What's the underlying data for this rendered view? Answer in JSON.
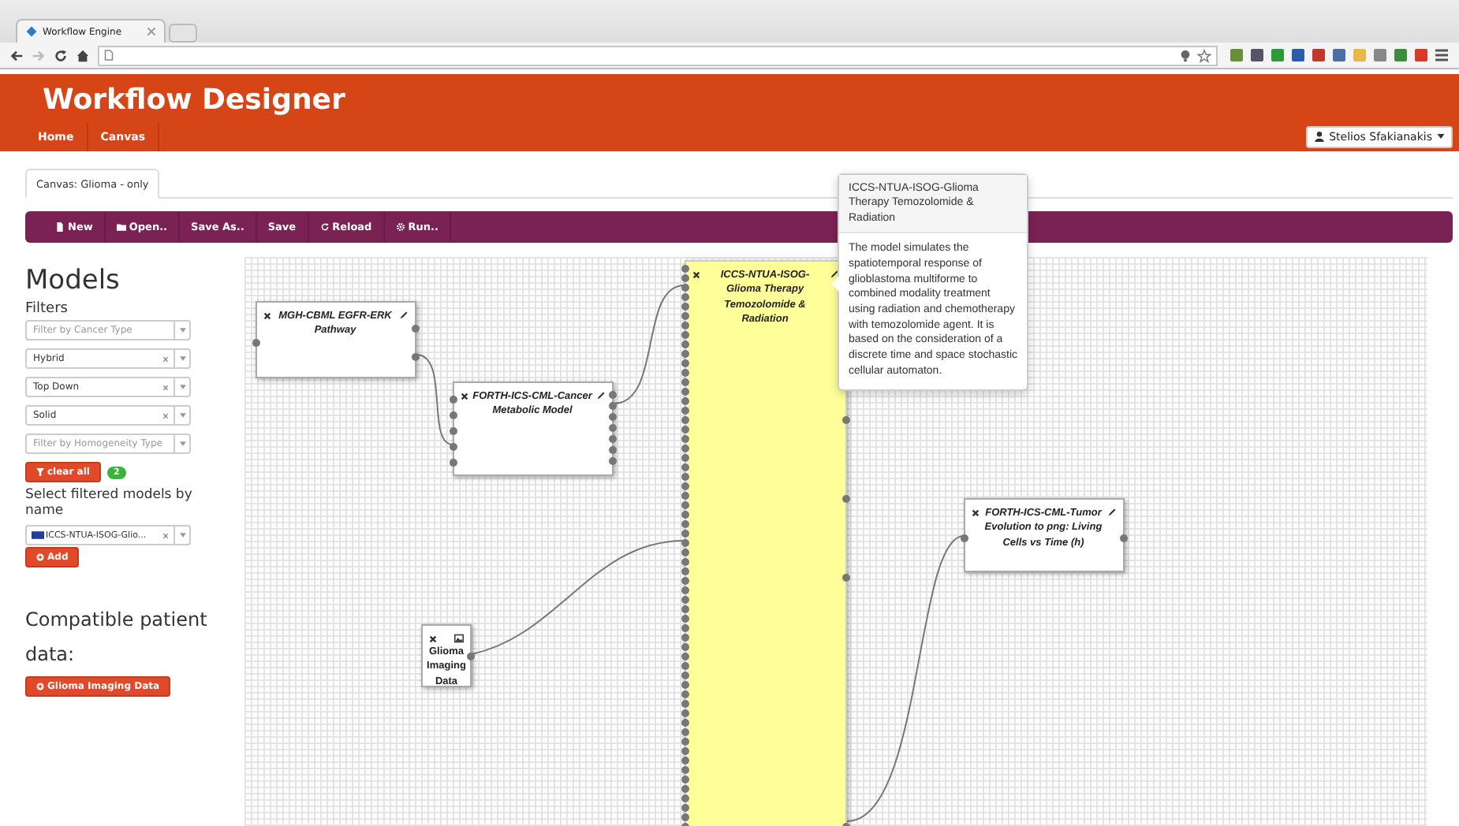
{
  "browser": {
    "tab_title": "Workflow Engine"
  },
  "app": {
    "title": "Workflow Designer",
    "nav": [
      {
        "label": "Home",
        "selected": false
      },
      {
        "label": "Canvas",
        "selected": false
      }
    ],
    "user": "Stelios Sfakianakis"
  },
  "canvas_tabs": [
    {
      "label": "Canvas: Glioma - only",
      "selected": true
    }
  ],
  "toolbar": [
    {
      "label": "New",
      "kind": "file"
    },
    {
      "label": "Open..",
      "kind": "folder"
    },
    {
      "label": "Save As..",
      "kind": "plain"
    },
    {
      "label": "Save",
      "kind": "plain"
    },
    {
      "label": "Reload",
      "kind": "reload"
    },
    {
      "label": "Run..",
      "kind": "gear"
    }
  ],
  "sidebar": {
    "title": "Models",
    "filters_label": "Filters",
    "filters": [
      {
        "placeholder": "Filter by Cancer Type"
      },
      {
        "value": "Hybrid"
      },
      {
        "value": "Top Down"
      },
      {
        "value": "Solid"
      },
      {
        "placeholder": "Filter by Homogeneity Type"
      }
    ],
    "clear_button": "clear all",
    "count_badge": "2",
    "select_label": "Select filtered models by name",
    "model_select": {
      "value": "ICCS-NTUA-ISOG-Glio..."
    },
    "add_button": "Add",
    "patient_heading": "Compatible patient data:",
    "patient_button": "Glioma Imaging Data"
  },
  "canvas": {
    "nodes": [
      {
        "title": "MGH-CBML EGFR-ERK Pathway",
        "kind": "model",
        "selected": false
      },
      {
        "title": "FORTH-ICS-CML-Cancer Metabolic Model",
        "kind": "model",
        "selected": false
      },
      {
        "title": "ICCS-NTUA-ISOG-Glioma Therapy Temozolomide & Radiation",
        "kind": "model",
        "selected": true
      },
      {
        "title": "Glioma Imaging Data",
        "kind": "data",
        "selected": false
      },
      {
        "title": "FORTH-ICS-CML-Tumor Evolution to png: Living Cells vs Time (h)",
        "kind": "model",
        "selected": false
      }
    ],
    "tooltip": {
      "title": "ICCS-NTUA-ISOG-Glioma Therapy Temozolomide & Radiation",
      "body": "The model simulates the spatiotemporal response of glioblastoma multiforme to combined modality treatment using radiation and chemotherapy with temozolomide agent. It is based on the consideration of a discrete time and space stochastic cellular automaton."
    }
  }
}
